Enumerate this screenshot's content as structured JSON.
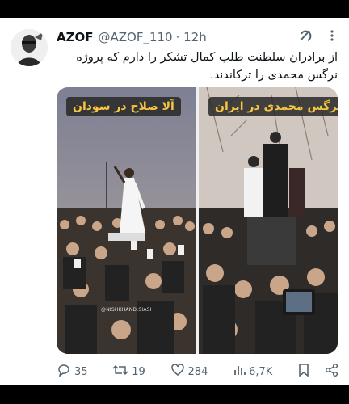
{
  "tweet": {
    "display_name": "AZOF",
    "handle": "@AZOF_110",
    "time": "· 12h",
    "text": "از برادران سلطنت طلب کمال تشکر را دارم که پروژه نرگس محمدی را ترکاندند."
  },
  "media": {
    "left_caption": "آلا صلاح در سودان",
    "right_caption": "نرگس محمدی در ایران",
    "watermark": "@NISHKHAND.SIASI"
  },
  "actions": {
    "replies": "35",
    "retweets": "19",
    "likes": "284",
    "views": "6,7K"
  },
  "icons": [
    "grok-icon",
    "more-icon",
    "reply-icon",
    "retweet-icon",
    "like-icon",
    "views-icon",
    "bookmark-icon",
    "share-icon"
  ],
  "colors": {
    "caption_text": "#f6c542",
    "text": "#0f1419",
    "muted": "#536471"
  }
}
